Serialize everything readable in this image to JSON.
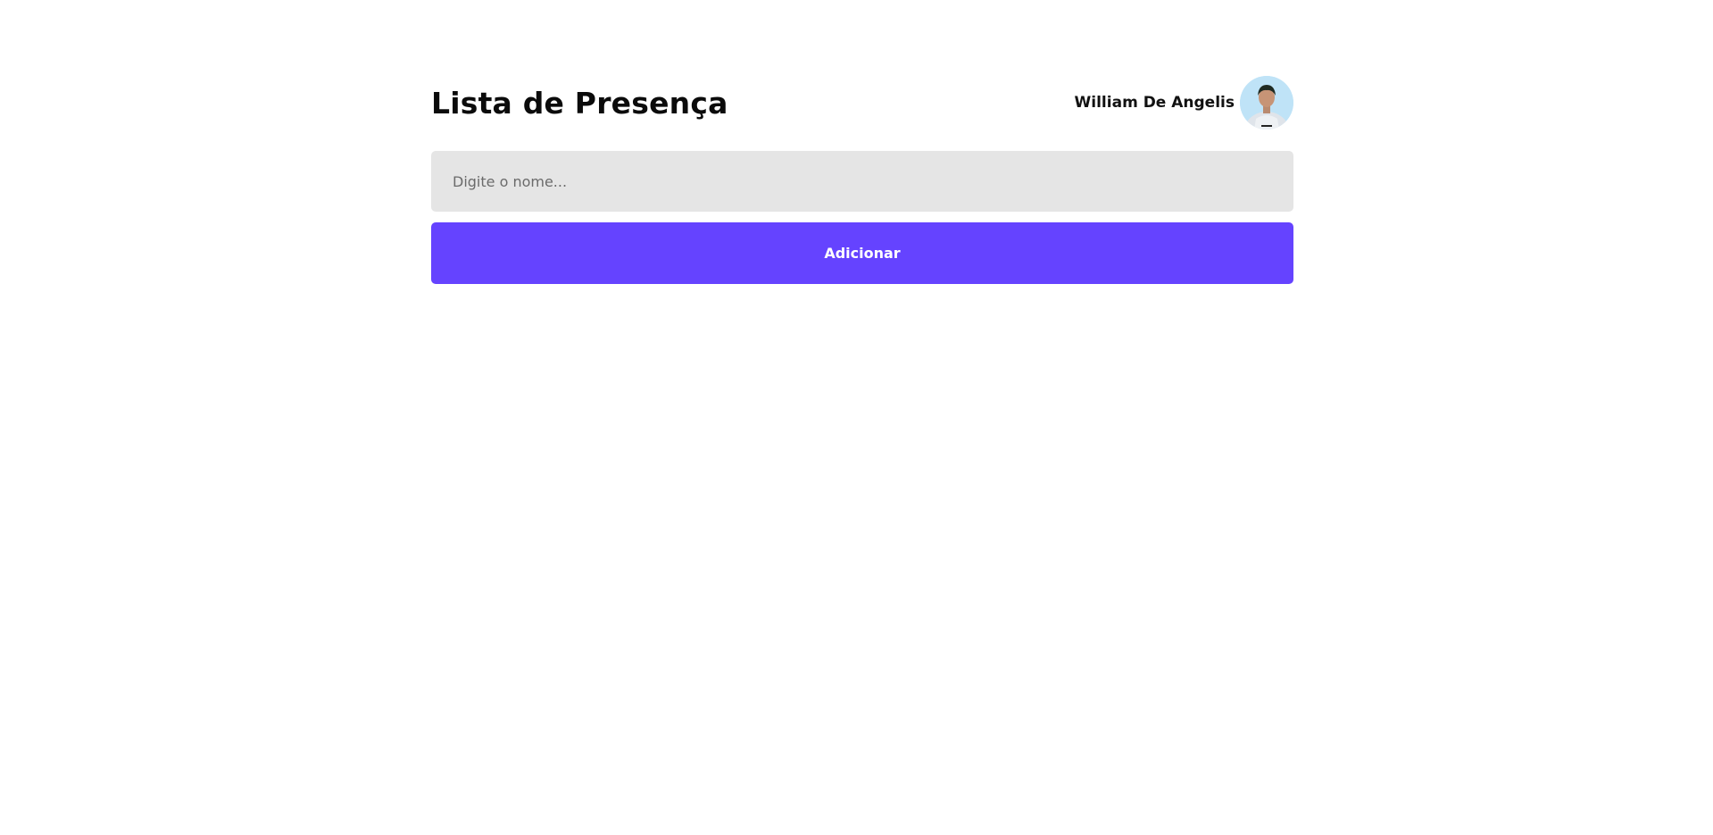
{
  "header": {
    "title": "Lista de Presença"
  },
  "user": {
    "name": "William De Angelis",
    "avatar_label": "avatar"
  },
  "form": {
    "input_placeholder": "Digite o nome...",
    "input_value": "",
    "button_label": "Adicionar"
  },
  "colors": {
    "accent": "#6543ff",
    "input_background": "#e5e5e5",
    "avatar_background": "#bfe3f7"
  }
}
